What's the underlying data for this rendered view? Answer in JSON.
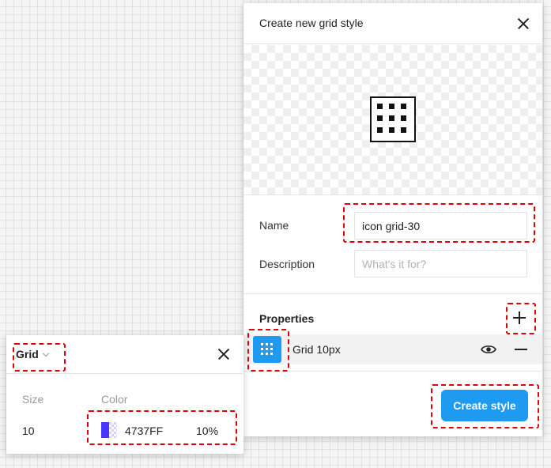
{
  "dialog": {
    "title": "Create new grid style",
    "close_icon": "close-icon",
    "name_label": "Name",
    "name_value": "icon grid-30",
    "description_label": "Description",
    "description_placeholder": "What's it for?",
    "properties_label": "Properties",
    "add_icon": "plus-icon",
    "property": {
      "name": "Grid 10px",
      "icon": "grid-icon",
      "visibility_icon": "eye-icon",
      "remove_icon": "minus-icon"
    },
    "create_button": "Create style",
    "accent_color": "#1e9bf0"
  },
  "grid_panel": {
    "type_label": "Grid",
    "type_icon": "chevron-down-icon",
    "close_icon": "close-icon",
    "size_header": "Size",
    "color_header": "Color",
    "size_value": "10",
    "color_hex": "4737FF",
    "color_swatch": "#4737FF",
    "opacity": "10%"
  },
  "annotation_color": "#e00000"
}
